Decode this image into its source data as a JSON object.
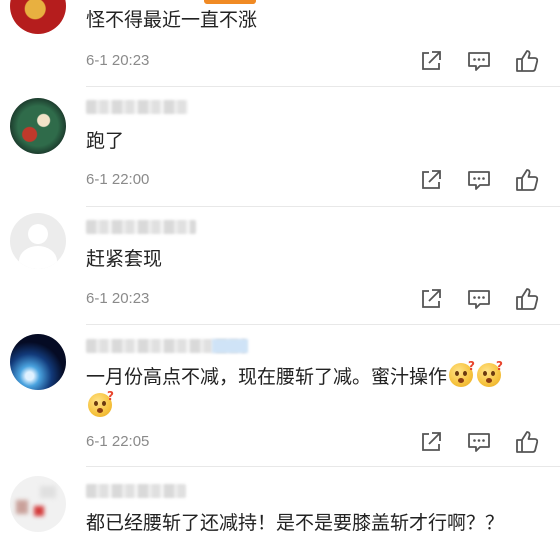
{
  "comments": [
    {
      "text": "怪不得最近一直不涨",
      "time": "6-1 20:23"
    },
    {
      "text": "跑了",
      "time": "6-1 22:00"
    },
    {
      "text": "赶紧套现",
      "time": "6-1 20:23"
    },
    {
      "text_line1": "一月份高点不减，现在腰斩了减。蜜汁操作",
      "time": "6-1 22:05"
    },
    {
      "text": "都已经腰斩了还减持！是不是要膝盖斩才行啊？？"
    }
  ],
  "icons": {
    "share": "share-icon",
    "comment": "comment-icon",
    "like": "thumbs-up-icon"
  },
  "colors": {
    "accent": "#f08a24",
    "icon": "#555555",
    "meta": "#8a8a8a"
  }
}
